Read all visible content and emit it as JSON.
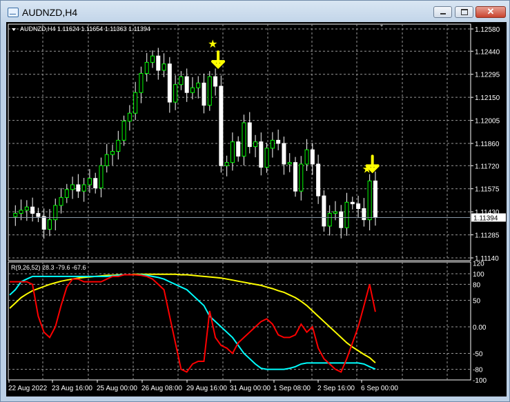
{
  "window": {
    "title": "AUDNZD,H4",
    "minimize": "minimize",
    "maximize": "maximize",
    "close": "✕"
  },
  "chart": {
    "header": "AUDNZD,H4  1.11624 1.11654 1.11363 1.11394",
    "symbol": "AUDNZD",
    "timeframe": "H4",
    "ohlc": {
      "open": "1.11624",
      "high": "1.11654",
      "low": "1.11363",
      "close": "1.11394"
    },
    "current_price_label": "1.11394",
    "price_axis": [
      "1.12580",
      "1.12440",
      "1.12295",
      "1.12150",
      "1.12005",
      "1.11860",
      "1.11720",
      "1.11575",
      "1.11430",
      "1.11285",
      "1.11140"
    ],
    "time_axis": [
      "22 Aug 2022",
      "23 Aug 16:00",
      "25 Aug 00:00",
      "26 Aug 08:00",
      "29 Aug 16:00",
      "31 Aug 00:00",
      "1 Sep 08:00",
      "2 Sep 16:00",
      "6 Sep 00:00"
    ],
    "closes": [
      1.114,
      1.1142,
      1.1144,
      1.1146,
      1.1142,
      1.114,
      1.1132,
      1.1138,
      1.1147,
      1.1152,
      1.1157,
      1.116,
      1.1156,
      1.116,
      1.1164,
      1.1158,
      1.1172,
      1.1179,
      1.1181,
      1.1188,
      1.12,
      1.1205,
      1.1218,
      1.123,
      1.1237,
      1.1241,
      1.1232,
      1.1236,
      1.1212,
      1.1223,
      1.1228,
      1.1218,
      1.1221,
      1.1224,
      1.121,
      1.1228,
      1.1222,
      1.1172,
      1.1174,
      1.1187,
      1.1178,
      1.1199,
      1.1184,
      1.1187,
      1.1171,
      1.1183,
      1.1188,
      1.1186,
      1.1173,
      1.1174,
      1.1156,
      1.1173,
      1.1182,
      1.1173,
      1.1153,
      1.1134,
      1.1142,
      1.1143,
      1.1133,
      1.1149,
      1.1148,
      1.1145,
      1.1138,
      1.11624,
      1.11394
    ],
    "signals": [
      {
        "type": "sell-arrow",
        "candle": 36
      },
      {
        "type": "sell-arrow",
        "candle": 63
      }
    ],
    "colors": {
      "bull_outline": "#00ff00",
      "bear_body": "#ffffff",
      "grid": "#c0c0c0",
      "arrow": "#ffff00"
    }
  },
  "indicator": {
    "label": "R(9,26,52) 28.3 -79.6 -67.6",
    "axis": [
      "120",
      "100",
      "80",
      "50",
      "0.00",
      "-50",
      "-80",
      "-100"
    ],
    "series": [
      {
        "name": "R9",
        "color": "#ff0000",
        "values": [
          85,
          85,
          85,
          85,
          80,
          20,
          -10,
          -20,
          0,
          40,
          75,
          90,
          90,
          85,
          85,
          85,
          85,
          90,
          95,
          95,
          98,
          98,
          98,
          97,
          95,
          90,
          80,
          70,
          20,
          -30,
          -80,
          -85,
          -70,
          -65,
          -65,
          30,
          -20,
          -35,
          -40,
          -50,
          -30,
          -20,
          -10,
          0,
          10,
          15,
          5,
          -15,
          -20,
          -20,
          -15,
          5,
          -10,
          0,
          -40,
          -60,
          -70,
          -80,
          -85,
          -60,
          -30,
          0,
          40,
          80,
          28.3
        ]
      },
      {
        "name": "R26",
        "color": "#00ffff",
        "values": [
          60,
          70,
          85,
          90,
          95,
          95,
          95,
          95,
          95,
          95,
          95,
          95,
          95,
          95,
          95,
          95,
          95,
          95,
          96,
          97,
          98,
          98,
          98,
          98,
          97,
          95,
          93,
          90,
          85,
          80,
          75,
          70,
          60,
          50,
          40,
          20,
          10,
          0,
          -10,
          -20,
          -35,
          -50,
          -60,
          -70,
          -78,
          -80,
          -80,
          -80,
          -80,
          -78,
          -75,
          -70,
          -68,
          -68,
          -68,
          -68,
          -68,
          -68,
          -68,
          -68,
          -68,
          -68,
          -70,
          -75,
          -79.6
        ]
      },
      {
        "name": "R52",
        "color": "#ffff00",
        "values": [
          35,
          45,
          55,
          62,
          68,
          72,
          76,
          80,
          83,
          86,
          88,
          90,
          92,
          93,
          94,
          95,
          96,
          97,
          97,
          98,
          98,
          98,
          99,
          99,
          99,
          99,
          99,
          99,
          99,
          99,
          98,
          98,
          97,
          96,
          95,
          94,
          93,
          92,
          90,
          88,
          86,
          84,
          82,
          80,
          78,
          75,
          72,
          68,
          65,
          60,
          55,
          48,
          40,
          30,
          20,
          10,
          0,
          -10,
          -20,
          -30,
          -38,
          -45,
          -52,
          -58,
          -67.6
        ]
      }
    ]
  }
}
